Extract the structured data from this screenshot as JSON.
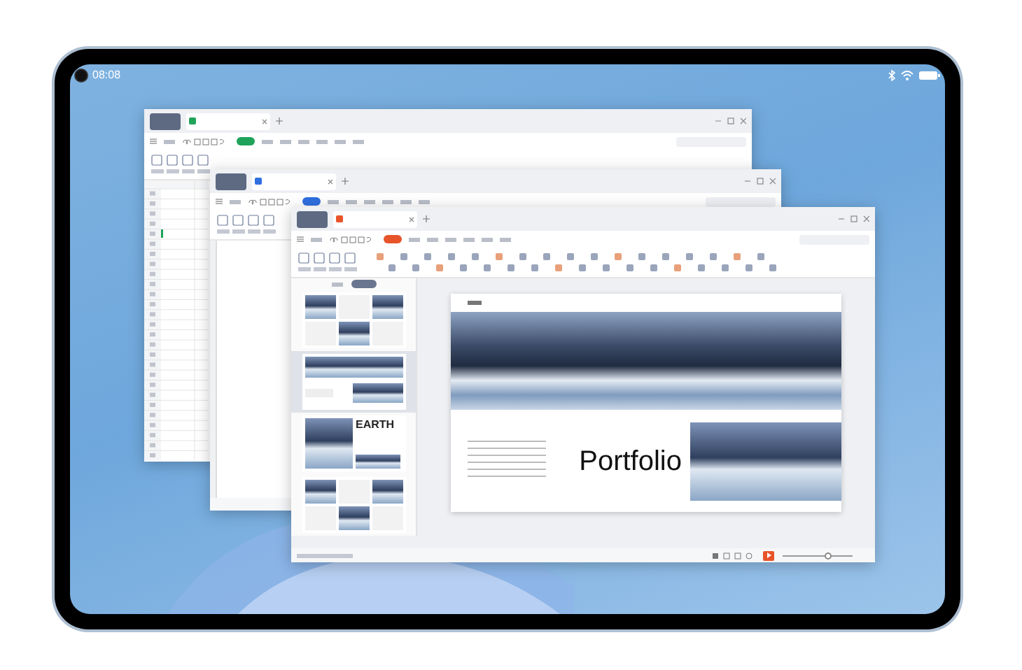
{
  "status_bar": {
    "time": "08:08"
  },
  "windows": [
    {
      "kind": "sheet",
      "color": "#1fa35a"
    },
    {
      "kind": "writer",
      "color": "#2f6fe0"
    },
    {
      "kind": "slides",
      "color": "#e8542a",
      "thumbnails": [
        {
          "selected": false,
          "kind": "collage"
        },
        {
          "selected": true,
          "kind": "title"
        },
        {
          "selected": false,
          "kind": "earth",
          "heading": "EARTH"
        },
        {
          "selected": false,
          "kind": "collage"
        }
      ],
      "slide": {
        "title": "Portfolio"
      },
      "zoom": {
        "level": 0.6
      }
    }
  ]
}
